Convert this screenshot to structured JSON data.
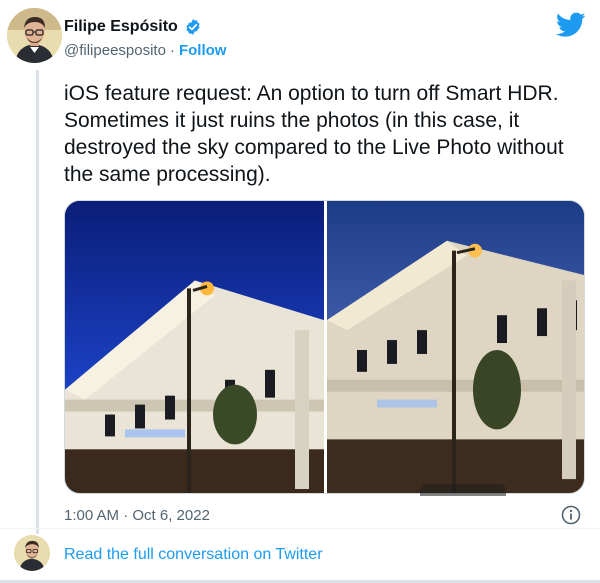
{
  "author": {
    "display_name": "Filipe Espósito",
    "handle": "@filipeesposito",
    "separator": "·",
    "follow_label": "Follow"
  },
  "tweet": {
    "text": "iOS feature request: An option to turn off Smart HDR. Sometimes it just ruins the photos (in this case, it destroyed the sky compared to the Live Photo without the same processing).",
    "timestamp": "1:00 AM · Oct 6, 2022"
  },
  "footer": {
    "read_link": "Read the full conversation on Twitter"
  },
  "icons": {
    "brand": "twitter-bird-icon",
    "verified": "verified-badge-icon",
    "info": "info-icon"
  },
  "colors": {
    "accent": "#1d9bf0",
    "secondary_text": "#536471",
    "primary_text": "#0f1419"
  }
}
